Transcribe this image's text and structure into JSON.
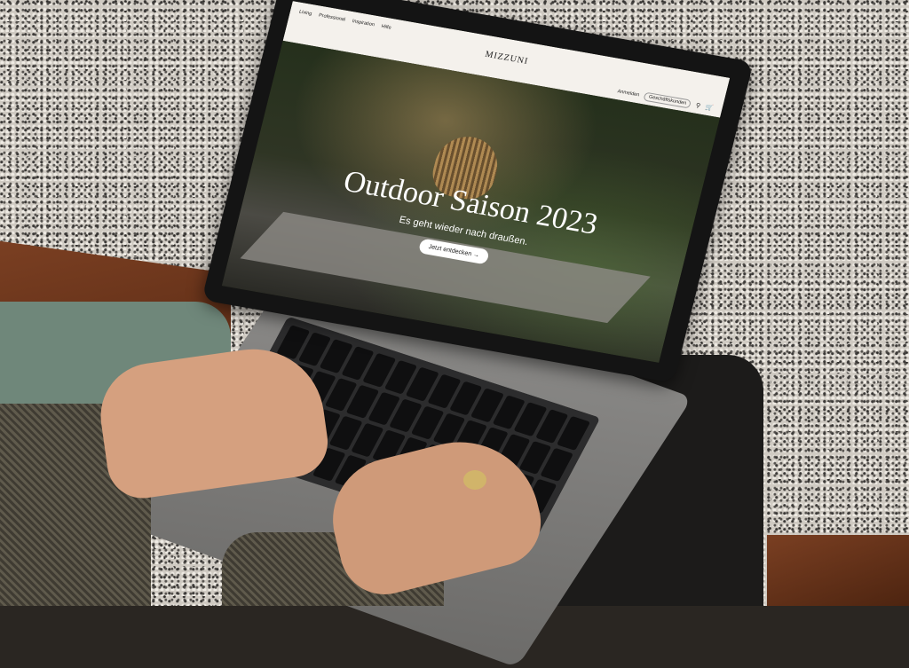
{
  "site": {
    "nav": [
      "Living",
      "Professional",
      "Inspiration",
      "Hilfe"
    ],
    "logo": "MIZZUNI",
    "login_label": "Anmelden",
    "business_label": "Geschäftskunden",
    "search_icon": "search-icon",
    "cart_icon": "cart-icon"
  },
  "hero": {
    "title": "Outdoor Saison 2023",
    "subtitle": "Es geht wieder nach draußen.",
    "cta_label": "Jetzt entdecken →"
  },
  "colors": {
    "topbar_bg": "#f4f1ec",
    "hero_text": "#ffffff",
    "cta_bg": "#ffffff"
  }
}
